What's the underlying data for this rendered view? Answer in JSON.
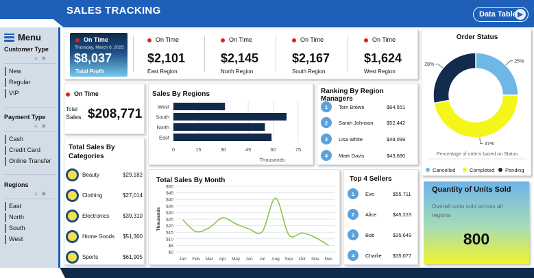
{
  "header": {
    "title": "SALES TRACKING",
    "data_table_button": "Data Table"
  },
  "sidebar": {
    "menu_label": "Menu",
    "sections": [
      {
        "title": "Customer Type",
        "items": [
          "New",
          "Regular",
          "VIP"
        ]
      },
      {
        "title": "Payment Type",
        "items": [
          "Cash",
          "Credit Card",
          "Online Transfer"
        ]
      },
      {
        "title": "Regions",
        "items": [
          "East",
          "North",
          "South",
          "West"
        ]
      }
    ]
  },
  "kpis": {
    "total": {
      "status": "On Time",
      "date": "Thursday, March 6, 2025",
      "value": "$8,037",
      "label": "Total Profit"
    },
    "regions": [
      {
        "status": "On Time",
        "value": "$2,101",
        "label": "East Region"
      },
      {
        "status": "On Time",
        "value": "$2,145",
        "label": "North Region"
      },
      {
        "status": "On Time",
        "value": "$2,167",
        "label": "South Region"
      },
      {
        "status": "On Time",
        "value": "$1,624",
        "label": "West Region"
      }
    ]
  },
  "total_sales": {
    "status": "On Time",
    "label_line1": "Total",
    "label_line2": "Sales",
    "value": "$208,771"
  },
  "categories": {
    "title_line1": "Total Sales By",
    "title_line2": "Categories",
    "items": [
      {
        "name": "Beauty",
        "value": "$29,182",
        "icon": "beauty-icon"
      },
      {
        "name": "Clothing",
        "value": "$27,014",
        "icon": "clothing-icon"
      },
      {
        "name": "Electronics",
        "value": "$39,310",
        "icon": "electronics-icon"
      },
      {
        "name": "Home Goods",
        "value": "$51,360",
        "icon": "home-goods-icon"
      },
      {
        "name": "Sports",
        "value": "$61,905",
        "icon": "sports-icon"
      }
    ]
  },
  "managers": {
    "title": "Ranking By Region Managers",
    "items": [
      {
        "rank": "1",
        "name": "Tom Brown",
        "value": "$64,551"
      },
      {
        "rank": "2",
        "name": "Sarah Johnson",
        "value": "$52,442"
      },
      {
        "rank": "3",
        "name": "Lisa White",
        "value": "$48,099"
      },
      {
        "rank": "4",
        "name": "Mark Davis",
        "value": "$43,680"
      }
    ]
  },
  "sellers": {
    "title": "Top 4 Sellers",
    "items": [
      {
        "rank": "1",
        "name": "Eve",
        "value": "$55,711"
      },
      {
        "rank": "2",
        "name": "Alice",
        "value": "$45,223"
      },
      {
        "rank": "3",
        "name": "Bob",
        "value": "$35,649"
      },
      {
        "rank": "4",
        "name": "Charlie",
        "value": "$35,077"
      }
    ]
  },
  "units": {
    "title": "Quantity of Units Sold",
    "subtitle": "Overall units sold across all regions",
    "value": "800"
  },
  "colors": {
    "accent": "#1e5fb8",
    "navy": "#0f2a4a",
    "bar": "#13294b",
    "line": "#8bc34a",
    "pie_cancelled": "#6fb8e6",
    "pie_completed": "#f5f51a",
    "pie_pending": "#132b4c",
    "status_dot": "#e01e1e"
  },
  "chart_data": [
    {
      "type": "bar",
      "orientation": "horizontal",
      "title": "Sales By Regions",
      "categories": [
        "West",
        "South",
        "North",
        "East"
      ],
      "values": [
        31,
        68,
        55,
        59
      ],
      "xlabel": "Thousands",
      "xlim": [
        0,
        75
      ],
      "xticks": [
        "0",
        "15",
        "30",
        "45",
        "60",
        "75"
      ],
      "grid": true
    },
    {
      "type": "line",
      "title": "Total Sales By Month",
      "ylabel": "Thousands",
      "categories": [
        "Jan",
        "Feb",
        "Mar",
        "Apr",
        "May",
        "Jun",
        "Jul",
        "Aug",
        "Sep",
        "Oct",
        "Nov",
        "Dec"
      ],
      "values": [
        24.5,
        15.5,
        18.5,
        26,
        21.5,
        17.5,
        15.5,
        41,
        13,
        14.5,
        11,
        5
      ],
      "ylim": [
        0,
        50
      ],
      "yticks": [
        "$0",
        "$5",
        "$10",
        "$15",
        "$20",
        "$25",
        "$30",
        "$35",
        "$40",
        "$45",
        "$50"
      ],
      "grid": true
    },
    {
      "type": "pie",
      "donut": true,
      "title": "Order Status",
      "caption": "Percentage of orders based on Status",
      "labels": [
        "Cancelled",
        "Completed",
        "Pending"
      ],
      "values": [
        25,
        47,
        28
      ],
      "data_labels": [
        "25%",
        "47%",
        "28%"
      ],
      "legend_position": "bottom"
    }
  ]
}
